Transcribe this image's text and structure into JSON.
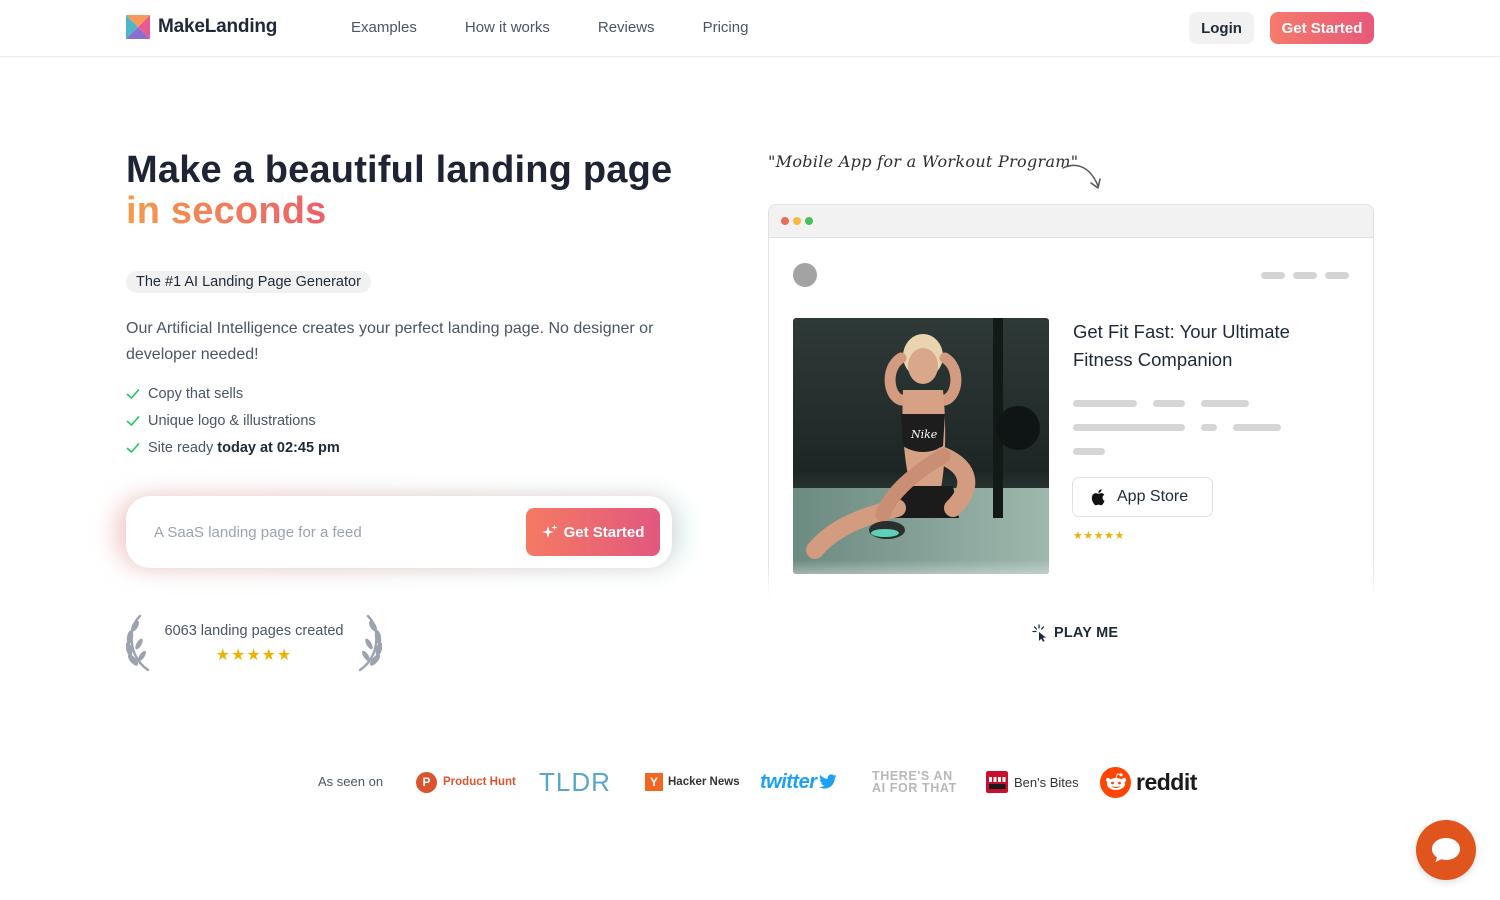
{
  "nav": {
    "brand": "MakeLanding",
    "links": [
      "Examples",
      "How it works",
      "Reviews",
      "Pricing"
    ],
    "login_label": "Login",
    "get_started_label": "Get Started"
  },
  "hero": {
    "title_line1": "Make a beautiful landing page",
    "title_line2": "in seconds",
    "badge": "The #1 AI Landing Page Generator",
    "description": "Our Artificial Intelligence creates your perfect landing page. No designer or developer needed!",
    "features": [
      {
        "text": "Copy that sells",
        "bold": ""
      },
      {
        "text": "Unique logo & illustrations",
        "bold": ""
      },
      {
        "text": "Site ready",
        "bold": "today at 02:45 pm"
      }
    ],
    "prompt": {
      "placeholder": "A SaaS landing page for a feed",
      "button_label": "Get Started"
    },
    "social_proof": {
      "text": "6063 landing pages created",
      "stars": "★★★★★",
      "rating": 5
    }
  },
  "preview": {
    "prompt_note": "\"Mobile App for a Workout Program\"",
    "heading": "Get Fit Fast: Your Ultimate Fitness Companion",
    "app_store_label": "App Store",
    "stars": "★★★★★",
    "play_label": "PLAY ME",
    "dot_colors": [
      "#ef6b5b",
      "#f5b942",
      "#4cbf5a"
    ]
  },
  "seen_on": {
    "label": "As seen on",
    "logos": {
      "product_hunt": "Product Hunt",
      "product_hunt_letter": "P",
      "tldr": "TLDR",
      "hacker_news": "Hacker News",
      "hacker_news_letter": "Y",
      "twitter": "twitter",
      "aift_line1": "THERE'S AN",
      "aift_line2": "AI FOR THAT",
      "bens_bites": "Ben's Bites",
      "reddit": "reddit"
    }
  },
  "colors": {
    "accent_start": "#f57a63",
    "accent_end": "#e2577f",
    "check": "#22c55e",
    "star": "#eab308",
    "chat": "#e0541d"
  }
}
